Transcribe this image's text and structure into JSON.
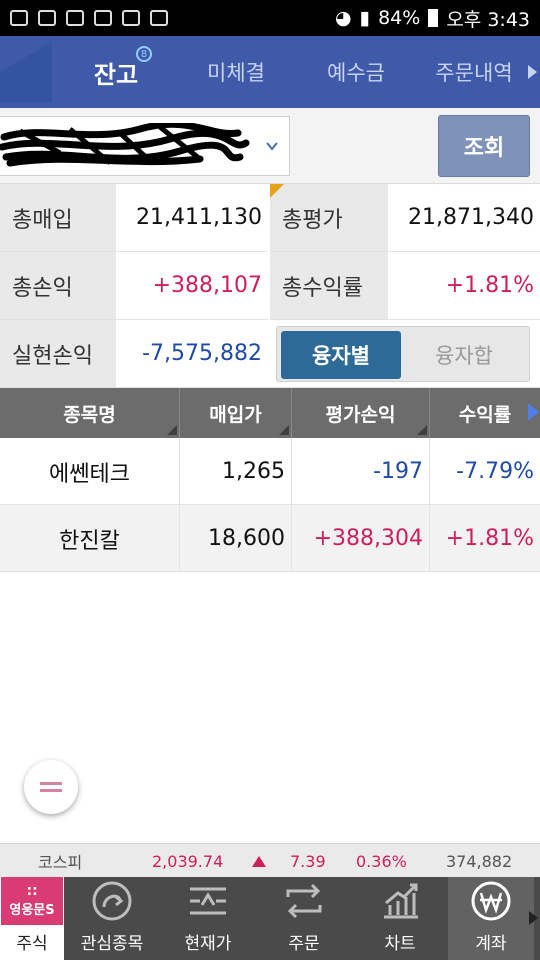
{
  "status_bar": {
    "battery": "84%",
    "time": "오후 3:43"
  },
  "tabs": [
    {
      "label": "잔고",
      "active": true,
      "badge": "8"
    },
    {
      "label": "미체결",
      "active": false
    },
    {
      "label": "예수금",
      "active": false
    },
    {
      "label": "주문내역",
      "active": false
    }
  ],
  "account": {
    "query_button": "조회"
  },
  "summary": {
    "total_purchase_label": "총매입",
    "total_purchase_value": "21,411,130",
    "total_eval_label": "총평가",
    "total_eval_value": "21,871,340",
    "total_pl_label": "총손익",
    "total_pl_value": "+388,107",
    "total_return_label": "총수익률",
    "total_return_value": "+1.81%",
    "realized_pl_label": "실현손익",
    "realized_pl_value": "-7,575,882",
    "toggle": {
      "option_a": "융자별",
      "option_b": "융자합",
      "selected": "융자별"
    }
  },
  "table": {
    "headers": [
      "종목명",
      "매입가",
      "평가손익",
      "수익률"
    ],
    "rows": [
      {
        "name": "에쎈테크",
        "price": "1,265",
        "pl": "-197",
        "rate": "-7.79%"
      },
      {
        "name": "한진칼",
        "price": "18,600",
        "pl": "+388,304",
        "rate": "+1.81%"
      }
    ]
  },
  "ticker": {
    "index_name": "코스피",
    "index_value": "2,039.74",
    "change": "7.39",
    "change_rate": "0.36%",
    "volume": "374,882"
  },
  "bottom_nav": [
    {
      "label": "주식",
      "icon": "brand-logo-icon",
      "brand_text": "영웅문S"
    },
    {
      "label": "관심종목",
      "icon": "star-ring-icon"
    },
    {
      "label": "현재가",
      "icon": "price-lines-icon"
    },
    {
      "label": "주문",
      "icon": "exchange-arrows-icon"
    },
    {
      "label": "차트",
      "icon": "chart-icon"
    },
    {
      "label": "계좌",
      "icon": "won-icon",
      "active": true
    }
  ],
  "colors": {
    "header_blue": "#3f5aa8",
    "positive_red": "#d01e5b",
    "negative_blue": "#1f4aa6",
    "toggle_active": "#2e6a98",
    "brand_pink": "#d93b73"
  }
}
